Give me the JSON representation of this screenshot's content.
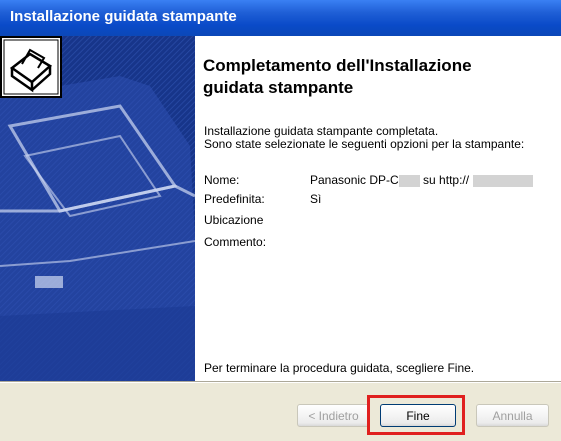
{
  "window": {
    "title": "Installazione guidata stampante"
  },
  "main": {
    "heading_line1": "Completamento dell'Installazione",
    "heading_line2": "guidata stampante",
    "desc_line1": "Installazione guidata stampante completata.",
    "desc_line2": "Sono state selezionate le seguenti opzioni per la stampante:",
    "rows": [
      {
        "label": "Nome:",
        "value_prefix": "Panasonic DP-C",
        "value_mid": " su http://"
      },
      {
        "label": "Predefinita:",
        "value": "Sì"
      },
      {
        "label": "Ubicazione",
        "value": ""
      },
      {
        "label": "Commento:",
        "value": ""
      }
    ],
    "finish_text": "Per terminare la procedura guidata, scegliere Fine."
  },
  "buttons": {
    "back": "< Indietro",
    "finish": "Fine",
    "cancel": "Annulla"
  },
  "colors": {
    "title_bar": "#0a4ac8",
    "highlight": "#e0201f",
    "sidebar": "#1b3b92"
  },
  "icons": {
    "wizard": "printer-icon"
  }
}
